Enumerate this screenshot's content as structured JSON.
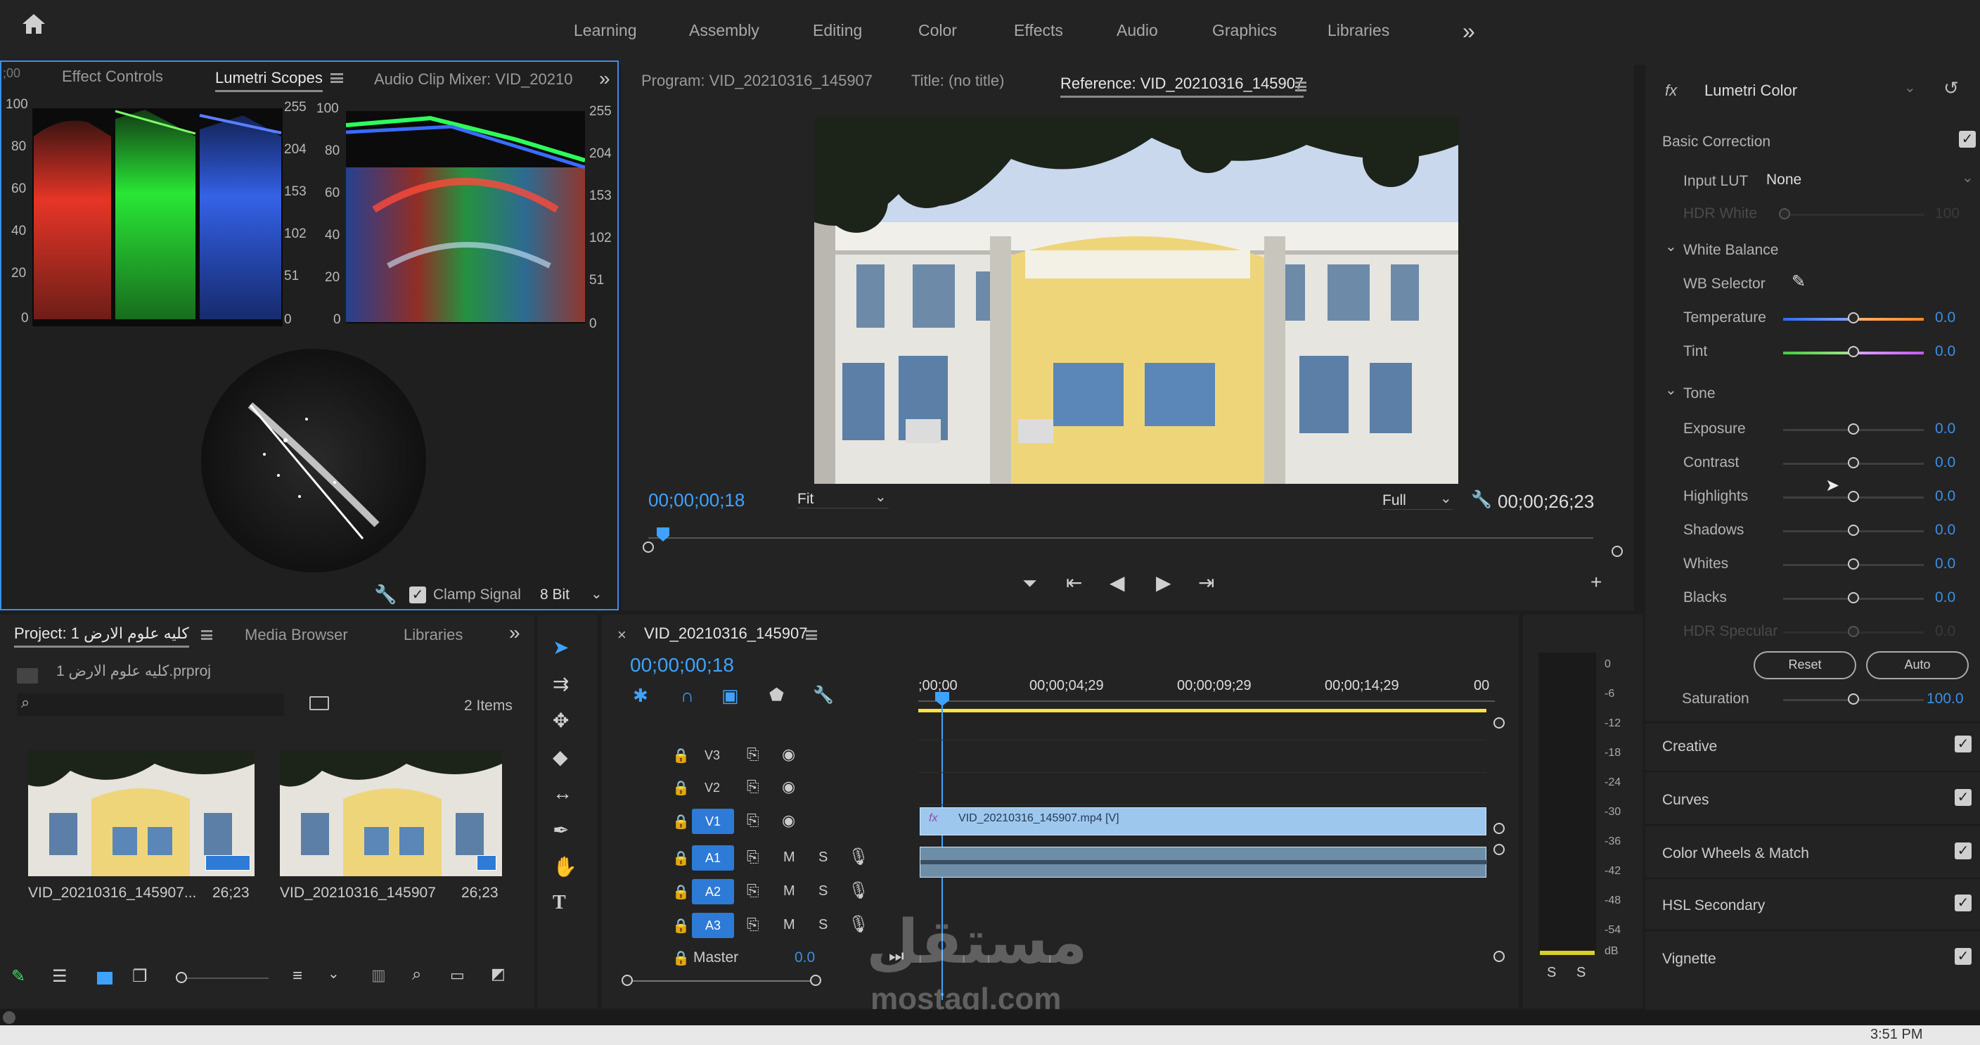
{
  "workspaces": {
    "items": [
      "Learning",
      "Assembly",
      "Editing",
      "Color",
      "Effects",
      "Audio",
      "Graphics",
      "Libraries"
    ],
    "more": "»"
  },
  "left_top": {
    "tabs": [
      "Effect Controls",
      "Lumetri Scopes",
      "Audio Clip Mixer: VID_20210"
    ],
    "active": "Lumetri Scopes",
    "clip_timecode": ";00",
    "parade_left_ticks": [
      "100",
      "80",
      "60",
      "40",
      "20",
      "0"
    ],
    "parade_right_ticks": [
      "255",
      "204",
      "153",
      "102",
      "51",
      "0"
    ],
    "wave_left_ticks": [
      "100",
      "80",
      "60",
      "40",
      "20",
      "0"
    ],
    "wave_right_ticks": [
      "255",
      "204",
      "153",
      "102",
      "51",
      "0"
    ],
    "clamp_signal_label": "Clamp Signal",
    "bit_depth": "8 Bit"
  },
  "program": {
    "tabs": [
      "Program: VID_20210316_145907",
      "Title: (no title)",
      "Reference: VID_20210316_145907"
    ],
    "active": "Reference: VID_20210316_145907",
    "timecode_in": "00;00;00;18",
    "fit": "Fit",
    "quality": "Full",
    "duration": "00;00;26;23"
  },
  "lumetri": {
    "fx": "fx",
    "title": "Lumetri Color",
    "basic_correction": "Basic Correction",
    "input_lut_label": "Input LUT",
    "input_lut_value": "None",
    "hdr_white": "HDR White",
    "hdr_white_val": "100",
    "white_balance": "White Balance",
    "wb_selector": "WB Selector",
    "temperature": {
      "label": "Temperature",
      "value": "0.0"
    },
    "tint": {
      "label": "Tint",
      "value": "0.0"
    },
    "tone": "Tone",
    "tone_items": [
      {
        "label": "Exposure",
        "value": "0.0"
      },
      {
        "label": "Contrast",
        "value": "0.0"
      },
      {
        "label": "Highlights",
        "value": "0.0"
      },
      {
        "label": "Shadows",
        "value": "0.0"
      },
      {
        "label": "Whites",
        "value": "0.0"
      },
      {
        "label": "Blacks",
        "value": "0.0"
      },
      {
        "label": "HDR Specular",
        "value": "0.0"
      }
    ],
    "reset": "Reset",
    "auto": "Auto",
    "saturation": {
      "label": "Saturation",
      "value": "100.0"
    },
    "sections": [
      "Creative",
      "Curves",
      "Color Wheels & Match",
      "HSL Secondary",
      "Vignette"
    ]
  },
  "project": {
    "tabs": [
      "Project: كليه علوم الارض 1",
      "Media Browser",
      "Libraries"
    ],
    "file": "كليه علوم الارض 1.prproj",
    "items_count": "2 Items",
    "clips": [
      {
        "name": "VID_20210316_145907...",
        "dur": "26;23"
      },
      {
        "name": "VID_20210316_145907",
        "dur": "26;23"
      }
    ]
  },
  "timeline": {
    "seq_name": "VID_20210316_145907",
    "timecode": "00;00;00;18",
    "ruler": [
      ";00;00",
      "00;00;04;29",
      "00;00;09;29",
      "00;00;14;29",
      "00"
    ],
    "video_tracks": [
      "V3",
      "V2",
      "V1"
    ],
    "audio_tracks": [
      "A1",
      "A2",
      "A3"
    ],
    "master": "Master",
    "master_val": "0.0",
    "clip_label": "VID_20210316_145907.mp4 [V]",
    "fx": "fx",
    "M": "M",
    "S": "S"
  },
  "meter": {
    "ticks": [
      "0",
      "-6",
      "-12",
      "-18",
      "-24",
      "-30",
      "-36",
      "-42",
      "-48",
      "-54",
      "dB"
    ],
    "solo": [
      "S",
      "S"
    ]
  },
  "watermark": {
    "arabic": "مستقل",
    "latin": "mostaql.com"
  },
  "taskbar": {
    "time": "3:51 PM"
  }
}
